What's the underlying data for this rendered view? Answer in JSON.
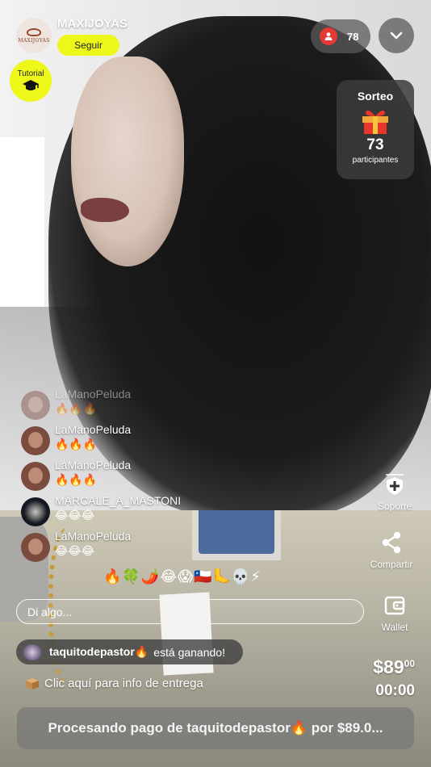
{
  "header": {
    "shop_name": "MAXIJOYAS",
    "shop_logo_text": "MAXIJOYAS",
    "follow_label": "Seguir",
    "tutorial_label": "Tutorial",
    "viewer_count": "78"
  },
  "raffle": {
    "title": "Sorteo",
    "count": "73",
    "subtitle": "participantes"
  },
  "chat": [
    {
      "user": "LaManoPeluda",
      "text": "🔥🔥🔥",
      "faded": true
    },
    {
      "user": "LaManoPeluda",
      "text": "🔥🔥🔥",
      "faded": false
    },
    {
      "user": "LaManoPeluda",
      "text": "🔥🔥🔥",
      "faded": false
    },
    {
      "user": "MÁRCALE_A_MASTONI",
      "text": "😂😂😂",
      "faded": false
    },
    {
      "user": "LaManoPeluda",
      "text": "😂😂😂",
      "faded": false
    }
  ],
  "actions": {
    "support_label": "Soporte",
    "share_label": "Compartir",
    "wallet_label": "Wallet"
  },
  "quick_emojis": "🔥🍀🌶️😂😱🇨🇱🦶💀⚡",
  "input": {
    "placeholder": "Di algo..."
  },
  "winner": {
    "name": "taquitodepastor🔥",
    "status": "está ganando!"
  },
  "delivery_text": "Clic aquí para info de entrega",
  "price": {
    "amount": "$89",
    "cents": "00"
  },
  "timer": "00:00",
  "payment_status": "Procesando pago de taquitodepastor🔥 por $89.0...",
  "colors": {
    "accent_yellow": "#eef71a",
    "live_red": "#e53935"
  }
}
